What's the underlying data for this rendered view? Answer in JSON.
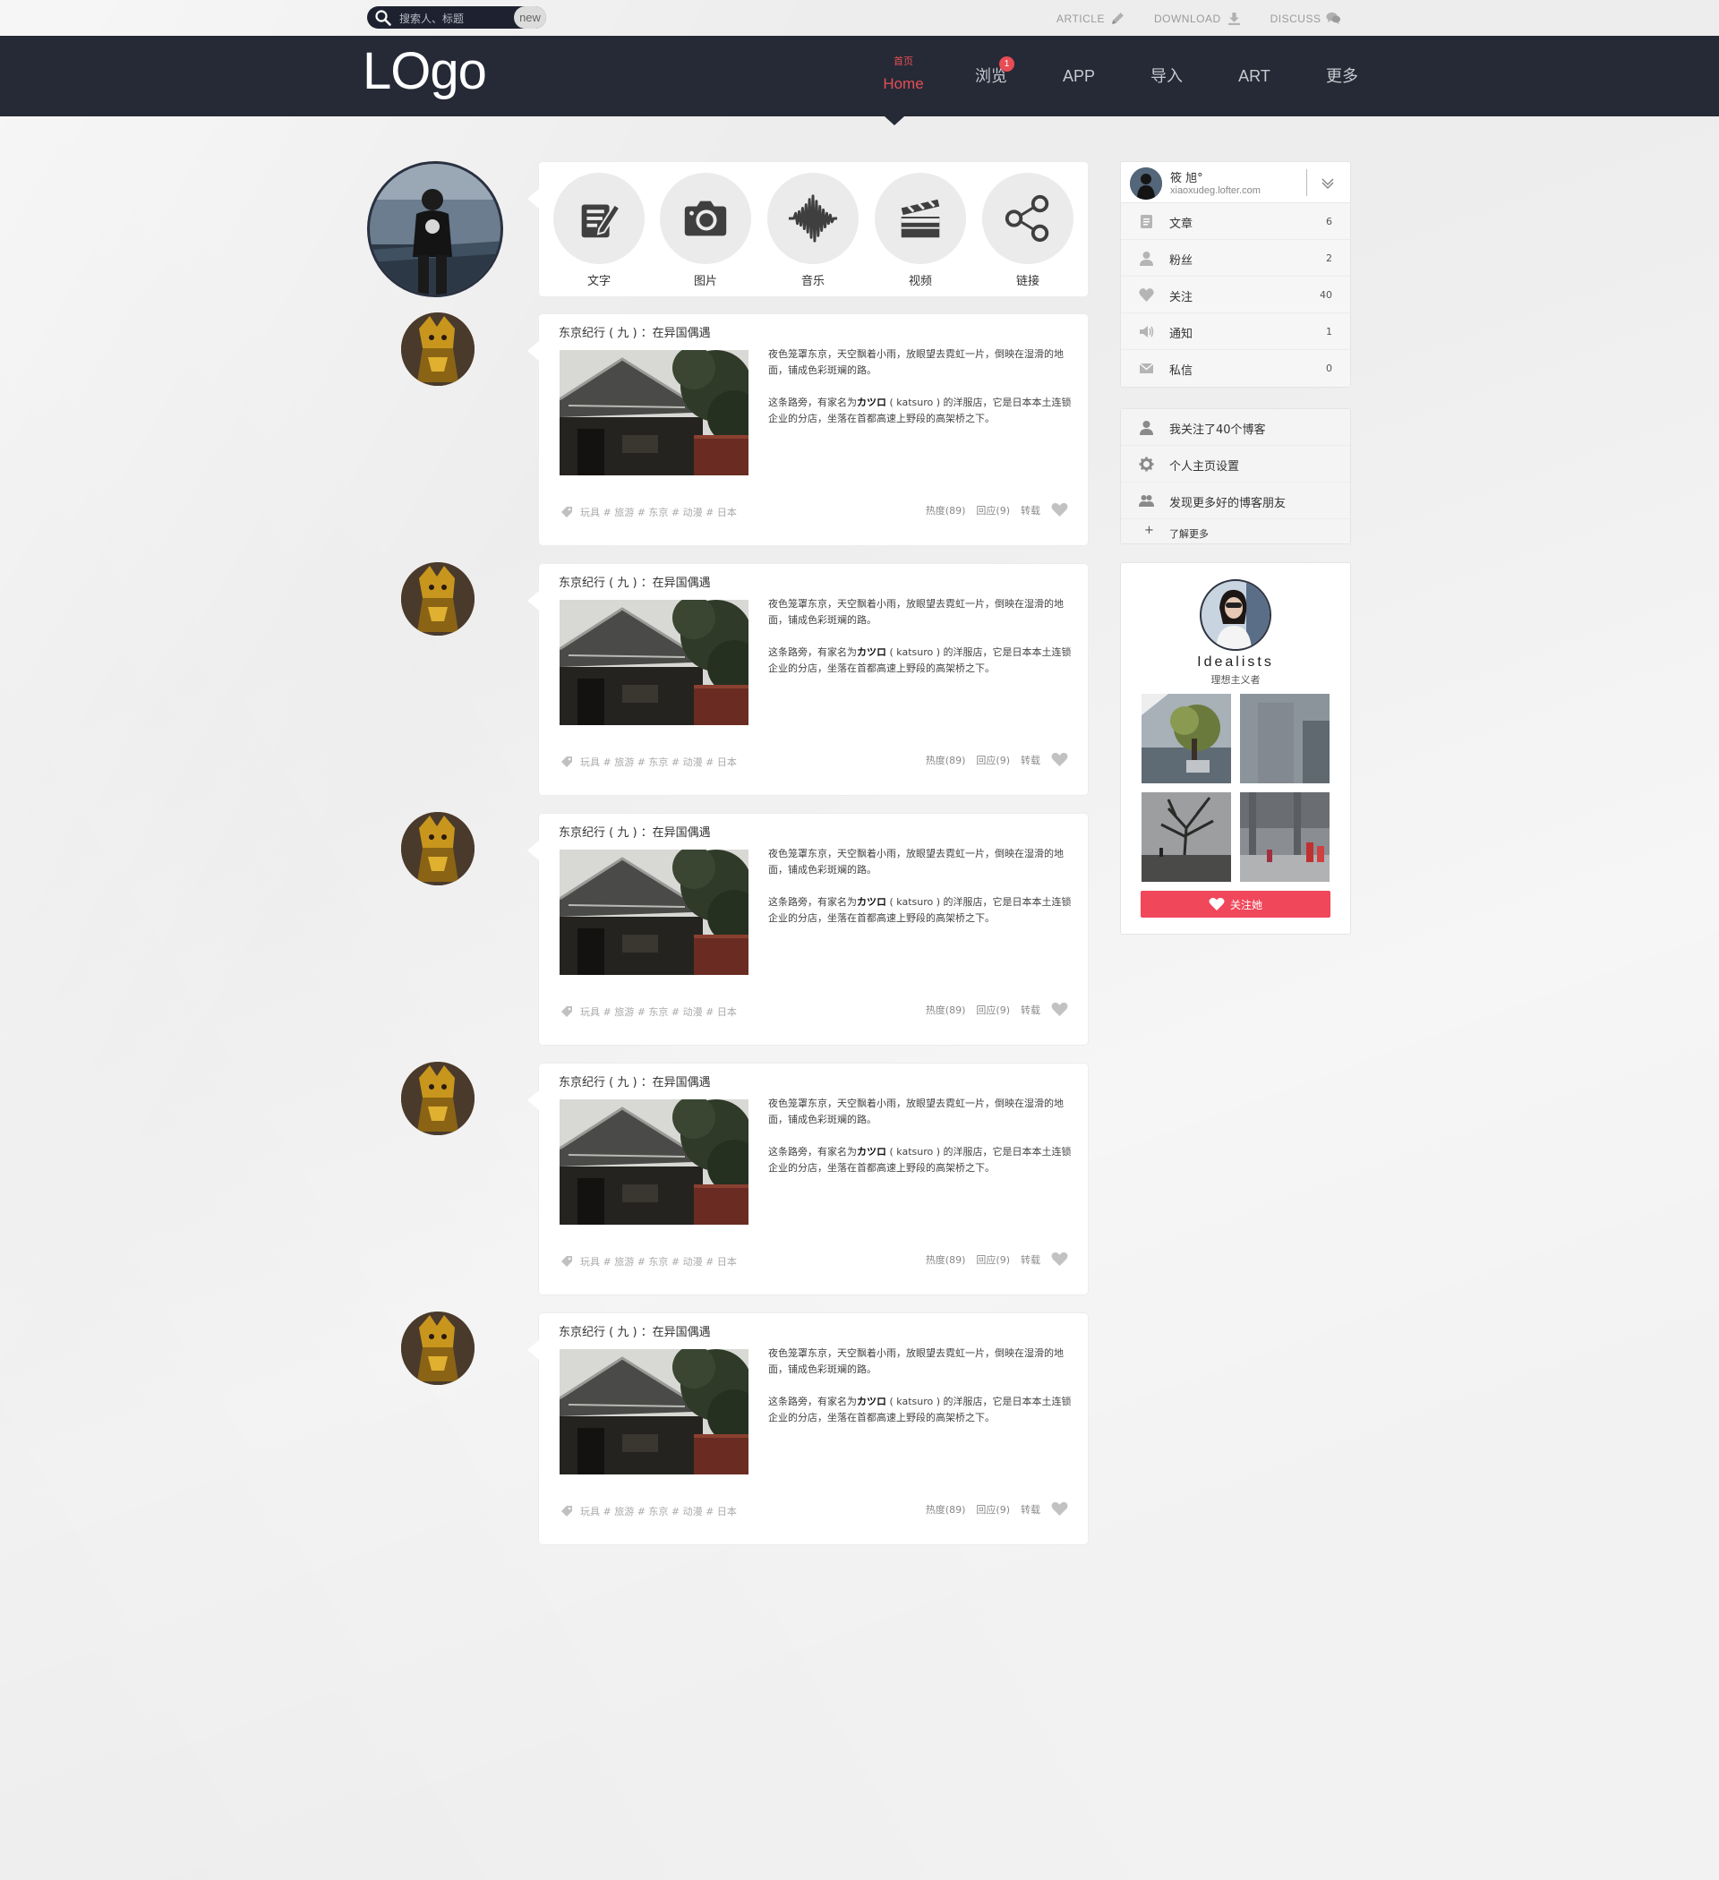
{
  "topbar": {
    "search_placeholder": "搜索人、标题",
    "new_label": "new",
    "links": [
      {
        "label": "ARTICLE",
        "icon": "pencil-icon"
      },
      {
        "label": "DOWNLOAD",
        "icon": "download-icon"
      },
      {
        "label": "DISCUSS",
        "icon": "chat-bubbles-icon"
      }
    ]
  },
  "header": {
    "logo": "LOgo",
    "nav": [
      {
        "label": "Home",
        "sub": "首页",
        "active": true
      },
      {
        "label": "浏览",
        "badge": "1"
      },
      {
        "label": "APP"
      },
      {
        "label": "导入"
      },
      {
        "label": "ART"
      },
      {
        "label": "更多"
      }
    ]
  },
  "post_types": [
    {
      "label": "文字",
      "icon": "edit-icon"
    },
    {
      "label": "图片",
      "icon": "camera-icon"
    },
    {
      "label": "音乐",
      "icon": "soundwave-icon"
    },
    {
      "label": "视频",
      "icon": "clapperboard-icon"
    },
    {
      "label": "链接",
      "icon": "share-icon"
    }
  ],
  "post": {
    "title": "东京纪行 ( 九 ) ：在异国偶遇",
    "para1": "夜色笼罩东京，天空飘着小雨，放眼望去霓虹一片，倒映在湿滑的地面，铺成色彩斑斓的路。",
    "para2_a": "这条路旁，有家名为",
    "para2_b": "カツロ",
    "para2_c": " ( katsuro ) 的洋服店，它是日本本土连锁企业的分店，坐落在首都高速上野段的高架桥之下。",
    "tags": "玩具 # 旅游 # 东京 # 动漫 # 日本",
    "hot": "热度(89)",
    "reply": "回应(9)",
    "repost": "转载"
  },
  "posts_count": 5,
  "sidebar": {
    "user_name": "筱 旭°",
    "user_url": "xiaoxudeg.lofter.com",
    "stats": [
      {
        "label": "文章",
        "count": "6",
        "icon": "document-icon"
      },
      {
        "label": "粉丝",
        "count": "2",
        "icon": "user-icon"
      },
      {
        "label": "关注",
        "count": "40",
        "icon": "heart-icon"
      },
      {
        "label": "通知",
        "count": "1",
        "icon": "speaker-icon"
      },
      {
        "label": "私信",
        "count": "0",
        "icon": "envelope-icon"
      }
    ],
    "links": [
      {
        "label": "我关注了40个博客",
        "icon": "user-icon"
      },
      {
        "label": "个人主页设置",
        "icon": "gear-icon"
      },
      {
        "label": "发现更多好的博客朋友",
        "icon": "users-icon"
      }
    ],
    "more_label": "了解更多",
    "more_plus": "+",
    "featured": {
      "name": "Idealists",
      "subtitle": "理想主义者",
      "follow_label": "关注她"
    }
  },
  "colors": {
    "header_bg": "#262a36",
    "accent_red": "#e44f55",
    "follow_button": "#f1475a",
    "page_bg": "#f3f3f3"
  }
}
